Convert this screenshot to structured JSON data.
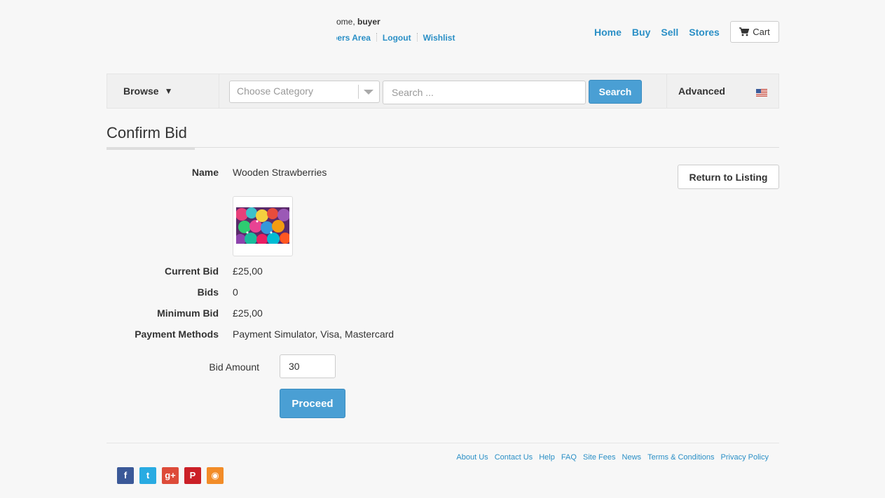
{
  "header": {
    "welcome_prefix": "ome, ",
    "username": "buyer",
    "user_links": [
      "bers Area",
      "Logout",
      "Wishlist"
    ],
    "nav": [
      "Home",
      "Buy",
      "Sell",
      "Stores"
    ],
    "cart_label": "Cart"
  },
  "searchbar": {
    "browse_label": "Browse",
    "category_placeholder": "Choose Category",
    "search_placeholder": "Search ...",
    "search_button": "Search",
    "advanced_label": "Advanced",
    "flag": "us-flag-icon"
  },
  "page": {
    "title": "Confirm Bid",
    "return_button": "Return to Listing"
  },
  "listing": {
    "name_label": "Name",
    "name": "Wooden Strawberries",
    "current_bid_label": "Current Bid",
    "current_bid": "£25,00",
    "bids_label": "Bids",
    "bids": "0",
    "minimum_bid_label": "Minimum Bid",
    "minimum_bid": "£25,00",
    "payment_methods_label": "Payment Methods",
    "payment_methods": "Payment Simulator, Visa, Mastercard"
  },
  "bid_form": {
    "amount_label": "Bid Amount",
    "amount_value": "30",
    "proceed_button": "Proceed"
  },
  "footer": {
    "links": [
      "About Us",
      "Contact Us",
      "Help",
      "FAQ",
      "Site Fees",
      "News",
      "Terms & Conditions",
      "Privacy Policy"
    ],
    "social": [
      "facebook-icon",
      "twitter-icon",
      "google-plus-icon",
      "pinterest-icon",
      "rss-icon"
    ]
  },
  "colors": {
    "link": "#2a8fc6",
    "primary_button": "#4a9fd4"
  }
}
